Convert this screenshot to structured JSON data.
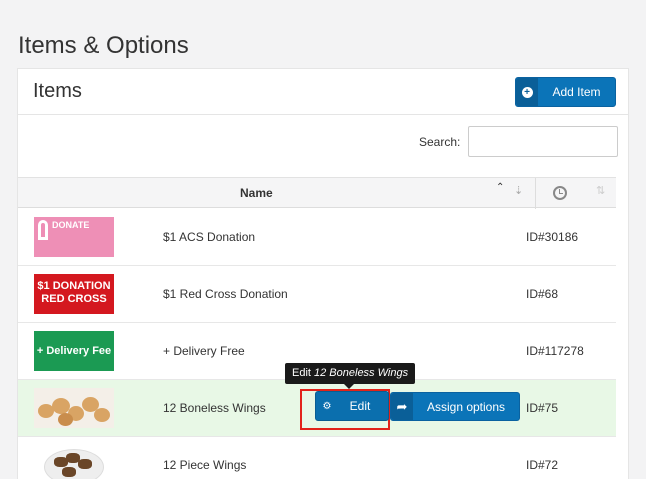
{
  "page": {
    "title": "Items & Options"
  },
  "card": {
    "title": "Items",
    "add_button_label": "Add Item"
  },
  "search": {
    "label": "Search:",
    "value": "",
    "placeholder": ""
  },
  "table": {
    "columns": [
      "Name"
    ],
    "rows": [
      {
        "thumb_text": "DONATE",
        "name": "$1 ACS Donation",
        "id": "ID#30186"
      },
      {
        "thumb_text": "$1 DONATION RED CROSS",
        "name": "$1 Red Cross Donation",
        "id": "ID#68"
      },
      {
        "thumb_text": "+ Delivery Fee",
        "name": "+ Delivery Free",
        "id": "ID#117278"
      },
      {
        "thumb_text": "",
        "name": "12 Boneless Wings",
        "id": "ID#75"
      },
      {
        "thumb_text": "",
        "name": "12 Piece Wings",
        "id": "ID#72"
      }
    ]
  },
  "row_actions": {
    "edit_label": "Edit",
    "assign_label": "Assign options"
  },
  "tooltip": {
    "prefix": "Edit ",
    "item": "12 Boneless Wings"
  },
  "icons": {
    "add": "plus-circle-icon",
    "sort": "sort-icon",
    "clock": "clock-icon",
    "edit": "gears-icon",
    "assign": "share-arrow-icon"
  },
  "colors": {
    "primary": "#0b74b8",
    "highlight_row": "#e8f8e6",
    "outline": "#e2231a"
  }
}
